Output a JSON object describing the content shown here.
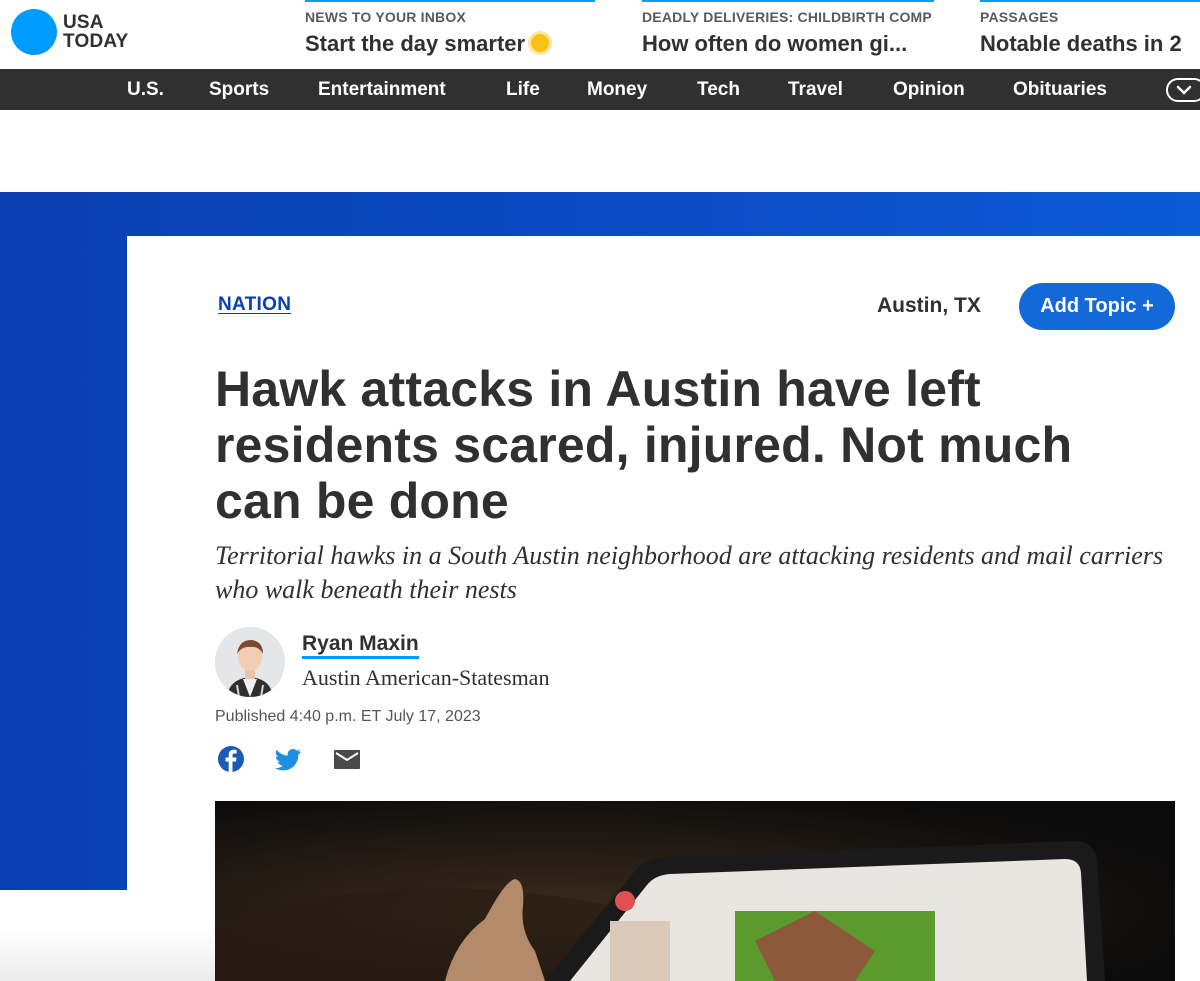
{
  "logo": {
    "line1": "USA",
    "line2": "TODAY"
  },
  "promos": [
    {
      "kicker": "NEWS TO YOUR INBOX",
      "title": "Start the day smarter"
    },
    {
      "kicker": "DEADLY DELIVERIES: CHILDBIRTH COMP",
      "title": "How often do women gi..."
    },
    {
      "kicker": "PASSAGES",
      "title": "Notable deaths in 2"
    }
  ],
  "nav": [
    "U.S.",
    "Sports",
    "Entertainment",
    "Life",
    "Money",
    "Tech",
    "Travel",
    "Opinion",
    "Obituaries"
  ],
  "article": {
    "topic": "NATION",
    "location": "Austin, TX",
    "add_topic": "Add Topic +",
    "headline": "Hawk attacks in Austin have left residents scared, injured. Not much can be done",
    "dek": "Territorial hawks in a South Austin neighborhood are attacking residents and mail carriers who walk beneath their nests",
    "author": "Ryan Maxin",
    "organization": "Austin American-Statesman",
    "published": "Published 4:40 p.m. ET July 17, 2023"
  },
  "share_icons": [
    "facebook-icon",
    "twitter-icon",
    "email-icon"
  ],
  "colors": {
    "brand_blue": "#009bff",
    "nav_bg": "#303030",
    "hero_blue": "#0a3fb2",
    "button_blue": "#1469d8"
  }
}
